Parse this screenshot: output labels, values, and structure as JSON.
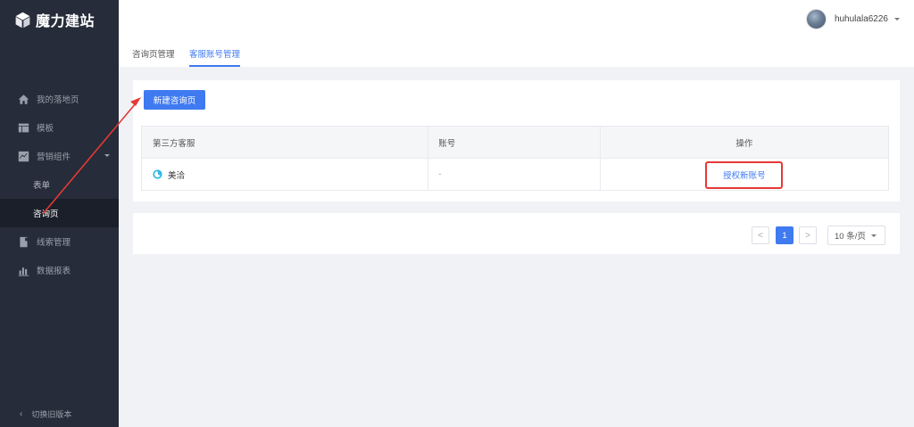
{
  "app": {
    "logo_text": "魔力建站"
  },
  "header": {
    "username": "huhulala6226"
  },
  "sidebar": {
    "items": [
      {
        "label": "我的落地页",
        "icon": "home-icon"
      },
      {
        "label": "模板",
        "icon": "template-icon"
      },
      {
        "label": "营销组件",
        "icon": "chart-line-icon",
        "expanded": true,
        "children": [
          {
            "label": "表单"
          },
          {
            "label": "咨询页",
            "active": true
          }
        ]
      },
      {
        "label": "线索管理",
        "icon": "book-icon"
      },
      {
        "label": "数据报表",
        "icon": "bar-chart-icon"
      }
    ],
    "switch_version": "切换旧版本"
  },
  "tabs": [
    {
      "label": "咨询页管理",
      "active": false
    },
    {
      "label": "客服账号管理",
      "active": true
    }
  ],
  "main": {
    "new_button": "新建咨询页",
    "table": {
      "headers": [
        "第三方客服",
        "账号",
        "操作"
      ],
      "rows": [
        {
          "provider": "美洽",
          "account": "-",
          "action": "授权新账号"
        }
      ]
    }
  },
  "pagination": {
    "prev": "<",
    "current_page": "1",
    "next": ">",
    "page_size": "10 条/页"
  },
  "colors": {
    "primary": "#3f7af0",
    "sidebar_bg": "#262c39",
    "annotation": "#e53935"
  }
}
